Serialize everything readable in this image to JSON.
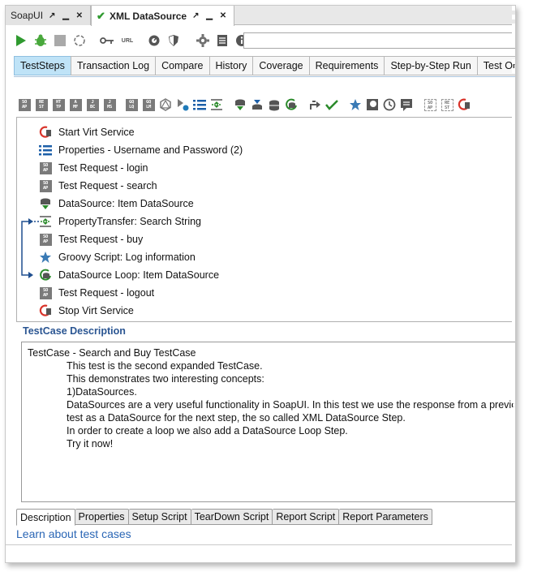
{
  "editor_tabs": [
    {
      "label": "SoapUI",
      "active": false
    },
    {
      "label": "XML DataSource",
      "active": true
    }
  ],
  "run_toolbar": {
    "icons": [
      "run-icon",
      "security-test-icon",
      "stop-icon",
      "loop-icon",
      "auth-icon",
      "url-icon",
      "options-icon",
      "security-icon",
      "settings-icon",
      "list-icon",
      "info-icon"
    ],
    "url_label": "URL",
    "search_value": ""
  },
  "view_tabs": [
    "TestSteps",
    "Transaction Log",
    "Compare",
    "History",
    "Coverage",
    "Requirements",
    "Step-by-Step Run",
    "Test On De"
  ],
  "step_toolbar": {
    "badges": [
      {
        "top": "SO",
        "bottom": "AP"
      },
      {
        "top": "RE",
        "bottom": "ST"
      },
      {
        "top": "HT",
        "bottom": "TP"
      },
      {
        "top": "A",
        "bottom": "MF"
      },
      {
        "top": "J",
        "bottom": "BC"
      },
      {
        "top": "J",
        "bottom": "MS"
      },
      {
        "top": "GQ",
        "bottom": "LQ"
      },
      {
        "top": "GQ",
        "bottom": "LM"
      },
      {
        "top": "SO",
        "bottom": "AP"
      },
      {
        "top": "RE",
        "bottom": "ST"
      }
    ]
  },
  "steps": [
    {
      "label": "Start Virt Service",
      "icon": "start-virt-icon"
    },
    {
      "label": "Properties - Username and Password (2)",
      "icon": "properties-icon"
    },
    {
      "label": "Test Request - login",
      "icon": "soap-request-icon"
    },
    {
      "label": "Test Request - search",
      "icon": "soap-request-icon"
    },
    {
      "label": "DataSource: Item DataSource",
      "icon": "datasource-icon"
    },
    {
      "label": "PropertyTransfer: Search String",
      "icon": "property-transfer-icon"
    },
    {
      "label": "Test Request - buy",
      "icon": "soap-request-icon"
    },
    {
      "label": "Groovy Script: Log information",
      "icon": "groovy-star-icon"
    },
    {
      "label": "DataSource Loop: Item DataSource",
      "icon": "datasource-loop-icon"
    },
    {
      "label": "Test Request - logout",
      "icon": "soap-request-icon"
    },
    {
      "label": "Stop Virt Service",
      "icon": "stop-virt-icon"
    }
  ],
  "soap_badge": {
    "top": "SO",
    "bottom": "AP"
  },
  "description": {
    "title": "TestCase Description",
    "lines": [
      {
        "text": "TestCase - Search and Buy TestCase",
        "indent": false
      },
      {
        "text": "",
        "indent": false
      },
      {
        "text": "This test is the second expanded TestCase.",
        "indent": true
      },
      {
        "text": "This demonstrates two interesting concepts:",
        "indent": true
      },
      {
        "text": "",
        "indent": false
      },
      {
        "text": "1)DataSources.",
        "indent": true
      },
      {
        "text": "DataSources are a very useful functionality in SoapUI. In this test we use the response from a previous",
        "indent": true
      },
      {
        "text": "test as a DataSource for the next step, the so called XML DataSource Step.",
        "indent": true
      },
      {
        "text": "In order to create a loop we also add a DataSource Loop Step.",
        "indent": true
      },
      {
        "text": "",
        "indent": false
      },
      {
        "text": "Try it now!",
        "indent": true
      }
    ]
  },
  "bottom_tabs": [
    "Description",
    "Properties",
    "Setup Script",
    "TearDown Script",
    "Report Script",
    "Report Parameters"
  ],
  "learn_link": "Learn about test cases",
  "colors": {
    "accent_blue": "#2a5592",
    "active_tab": "#bfe3f7",
    "run_green": "#2f9a2f",
    "virt_red": "#d9342b",
    "link": "#2a66b5"
  }
}
